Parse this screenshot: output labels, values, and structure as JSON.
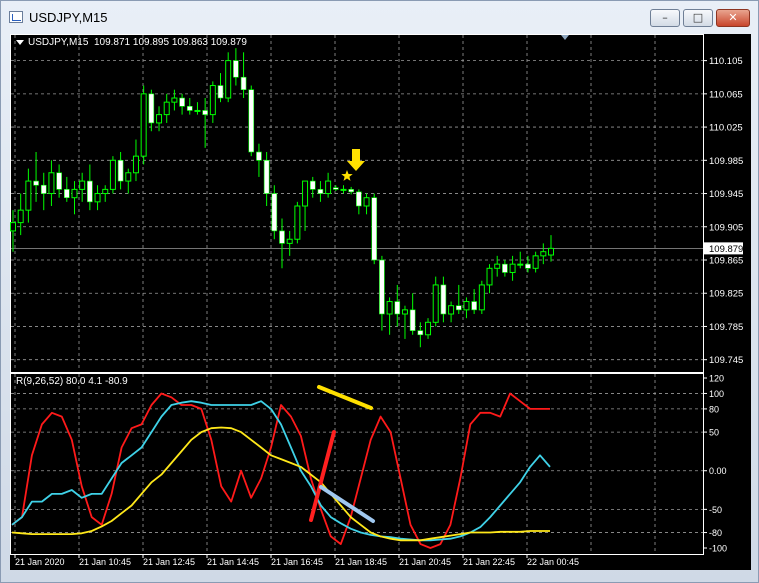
{
  "window": {
    "title": "USDJPY,M15",
    "minimize_glyph": "–",
    "maximize_glyph": "□",
    "close_glyph": "✕"
  },
  "chart_header": {
    "symbol": "USDJPY,M15",
    "ohlc": "109.871 109.895 109.863 109.879"
  },
  "indicator_header": {
    "label": "R(9,26,52) 80.0 4.1 -80.9"
  },
  "colors": {
    "background": "#000000",
    "grid": "#9a9a9a",
    "bull_candle": "#ffffff",
    "wick": "#00ff00",
    "current_price_line": "#9a9a9a",
    "red_line": "#ff1a1a",
    "cyan_line": "#3fd2e8",
    "yellow_line": "#ffe81a",
    "annotation_yellow": "#ffe000",
    "annotation_red": "#ff2020",
    "annotation_blue": "#a0c8f0"
  },
  "annotations": {
    "arrow": "down-arrow",
    "star": "star"
  },
  "chart_data": [
    {
      "type": "candlestick",
      "title": "USDJPY,M15",
      "ylim": [
        109.735,
        110.125
      ],
      "y_ticks": [
        "110.105",
        "110.065",
        "110.025",
        "109.985",
        "109.945",
        "109.905",
        "109.865",
        "109.825",
        "109.785",
        "109.745"
      ],
      "current_price": "109.879",
      "x_ticks": [
        "21 Jan 2020",
        "21 Jan 10:45",
        "21 Jan 12:45",
        "21 Jan 14:45",
        "21 Jan 16:45",
        "21 Jan 18:45",
        "21 Jan 20:45",
        "21 Jan 22:45",
        "22 Jan 00:45"
      ],
      "candles": [
        {
          "o": 109.9,
          "h": 109.925,
          "l": 109.875,
          "c": 109.91
        },
        {
          "o": 109.91,
          "h": 109.945,
          "l": 109.895,
          "c": 109.925
        },
        {
          "o": 109.925,
          "h": 109.975,
          "l": 109.91,
          "c": 109.96
        },
        {
          "o": 109.96,
          "h": 109.995,
          "l": 109.935,
          "c": 109.955
        },
        {
          "o": 109.955,
          "h": 109.97,
          "l": 109.925,
          "c": 109.945
        },
        {
          "o": 109.945,
          "h": 109.985,
          "l": 109.93,
          "c": 109.97
        },
        {
          "o": 109.97,
          "h": 109.98,
          "l": 109.94,
          "c": 109.95
        },
        {
          "o": 109.95,
          "h": 109.965,
          "l": 109.935,
          "c": 109.94
        },
        {
          "o": 109.94,
          "h": 109.96,
          "l": 109.92,
          "c": 109.95
        },
        {
          "o": 109.95,
          "h": 109.97,
          "l": 109.935,
          "c": 109.96
        },
        {
          "o": 109.96,
          "h": 109.98,
          "l": 109.925,
          "c": 109.935
        },
        {
          "o": 109.935,
          "h": 109.955,
          "l": 109.925,
          "c": 109.945
        },
        {
          "o": 109.945,
          "h": 109.955,
          "l": 109.935,
          "c": 109.95
        },
        {
          "o": 109.95,
          "h": 109.99,
          "l": 109.945,
          "c": 109.985
        },
        {
          "o": 109.985,
          "h": 109.995,
          "l": 109.95,
          "c": 109.96
        },
        {
          "o": 109.96,
          "h": 109.975,
          "l": 109.945,
          "c": 109.97
        },
        {
          "o": 109.97,
          "h": 110.01,
          "l": 109.96,
          "c": 109.99
        },
        {
          "o": 109.99,
          "h": 110.075,
          "l": 109.98,
          "c": 110.065
        },
        {
          "o": 110.065,
          "h": 110.07,
          "l": 110.02,
          "c": 110.03
        },
        {
          "o": 110.03,
          "h": 110.05,
          "l": 110.02,
          "c": 110.04
        },
        {
          "o": 110.04,
          "h": 110.065,
          "l": 110.03,
          "c": 110.055
        },
        {
          "o": 110.055,
          "h": 110.07,
          "l": 110.045,
          "c": 110.06
        },
        {
          "o": 110.06,
          "h": 110.065,
          "l": 110.04,
          "c": 110.05
        },
        {
          "o": 110.05,
          "h": 110.06,
          "l": 110.04,
          "c": 110.045
        },
        {
          "o": 110.045,
          "h": 110.055,
          "l": 110.04,
          "c": 110.045
        },
        {
          "o": 110.045,
          "h": 110.06,
          "l": 110.0,
          "c": 110.04
        },
        {
          "o": 110.04,
          "h": 110.08,
          "l": 110.03,
          "c": 110.075
        },
        {
          "o": 110.075,
          "h": 110.09,
          "l": 110.055,
          "c": 110.06
        },
        {
          "o": 110.06,
          "h": 110.115,
          "l": 110.055,
          "c": 110.105
        },
        {
          "o": 110.105,
          "h": 110.12,
          "l": 110.075,
          "c": 110.085
        },
        {
          "o": 110.085,
          "h": 110.115,
          "l": 110.06,
          "c": 110.07
        },
        {
          "o": 110.07,
          "h": 110.075,
          "l": 109.99,
          "c": 109.995
        },
        {
          "o": 109.995,
          "h": 110.005,
          "l": 109.965,
          "c": 109.985
        },
        {
          "o": 109.985,
          "h": 109.995,
          "l": 109.93,
          "c": 109.945
        },
        {
          "o": 109.945,
          "h": 109.955,
          "l": 109.89,
          "c": 109.9
        },
        {
          "o": 109.9,
          "h": 109.915,
          "l": 109.855,
          "c": 109.885
        },
        {
          "o": 109.885,
          "h": 109.9,
          "l": 109.87,
          "c": 109.89
        },
        {
          "o": 109.89,
          "h": 109.935,
          "l": 109.885,
          "c": 109.93
        },
        {
          "o": 109.93,
          "h": 109.96,
          "l": 109.9,
          "c": 109.96
        },
        {
          "o": 109.96,
          "h": 109.965,
          "l": 109.94,
          "c": 109.95
        },
        {
          "o": 109.95,
          "h": 109.96,
          "l": 109.935,
          "c": 109.945
        },
        {
          "o": 109.945,
          "h": 109.97,
          "l": 109.94,
          "c": 109.96
        },
        {
          "o": 109.952,
          "h": 109.955,
          "l": 109.948,
          "c": 109.95
        },
        {
          "o": 109.95,
          "h": 109.955,
          "l": 109.945,
          "c": 109.95
        },
        {
          "o": 109.95,
          "h": 109.953,
          "l": 109.944,
          "c": 109.947
        },
        {
          "o": 109.947,
          "h": 109.95,
          "l": 109.92,
          "c": 109.93
        },
        {
          "o": 109.93,
          "h": 109.945,
          "l": 109.92,
          "c": 109.94
        },
        {
          "o": 109.94,
          "h": 109.945,
          "l": 109.86,
          "c": 109.865
        },
        {
          "o": 109.865,
          "h": 109.87,
          "l": 109.78,
          "c": 109.8
        },
        {
          "o": 109.8,
          "h": 109.82,
          "l": 109.775,
          "c": 109.815
        },
        {
          "o": 109.815,
          "h": 109.835,
          "l": 109.785,
          "c": 109.8
        },
        {
          "o": 109.8,
          "h": 109.81,
          "l": 109.77,
          "c": 109.805
        },
        {
          "o": 109.805,
          "h": 109.825,
          "l": 109.775,
          "c": 109.78
        },
        {
          "o": 109.78,
          "h": 109.79,
          "l": 109.76,
          "c": 109.775
        },
        {
          "o": 109.775,
          "h": 109.795,
          "l": 109.77,
          "c": 109.79
        },
        {
          "o": 109.79,
          "h": 109.845,
          "l": 109.785,
          "c": 109.835
        },
        {
          "o": 109.835,
          "h": 109.845,
          "l": 109.79,
          "c": 109.8
        },
        {
          "o": 109.8,
          "h": 109.815,
          "l": 109.79,
          "c": 109.81
        },
        {
          "o": 109.81,
          "h": 109.835,
          "l": 109.8,
          "c": 109.805
        },
        {
          "o": 109.805,
          "h": 109.82,
          "l": 109.795,
          "c": 109.815
        },
        {
          "o": 109.815,
          "h": 109.83,
          "l": 109.8,
          "c": 109.805
        },
        {
          "o": 109.805,
          "h": 109.84,
          "l": 109.8,
          "c": 109.835
        },
        {
          "o": 109.835,
          "h": 109.86,
          "l": 109.825,
          "c": 109.855
        },
        {
          "o": 109.855,
          "h": 109.87,
          "l": 109.845,
          "c": 109.86
        },
        {
          "o": 109.86,
          "h": 109.865,
          "l": 109.845,
          "c": 109.85
        },
        {
          "o": 109.85,
          "h": 109.87,
          "l": 109.84,
          "c": 109.86
        },
        {
          "o": 109.86,
          "h": 109.875,
          "l": 109.855,
          "c": 109.86
        },
        {
          "o": 109.86,
          "h": 109.87,
          "l": 109.85,
          "c": 109.855
        },
        {
          "o": 109.855,
          "h": 109.875,
          "l": 109.85,
          "c": 109.87
        },
        {
          "o": 109.87,
          "h": 109.885,
          "l": 109.86,
          "c": 109.875
        },
        {
          "o": 109.871,
          "h": 109.895,
          "l": 109.863,
          "c": 109.879
        }
      ]
    },
    {
      "type": "line",
      "title": "R(9,26,52) 80.0 4.1 -80.9",
      "ylim": [
        -100,
        120
      ],
      "y_ticks": [
        "120",
        "100",
        "80",
        "50",
        "0.00",
        "-50",
        "-80",
        "-100"
      ],
      "series": [
        {
          "color": "red",
          "values": [
            -70,
            -60,
            20,
            60,
            75,
            70,
            40,
            -20,
            -60,
            -70,
            -30,
            30,
            55,
            60,
            85,
            100,
            95,
            85,
            85,
            80,
            40,
            -20,
            -40,
            0,
            -35,
            -10,
            30,
            85,
            70,
            45,
            -10,
            -50,
            -85,
            -95,
            -60,
            -10,
            40,
            70,
            50,
            -10,
            -70,
            -95,
            -100,
            -95,
            -70,
            -10,
            60,
            75,
            75,
            70,
            100,
            90,
            80,
            80,
            80
          ]
        },
        {
          "color": "cyan",
          "values": [
            -70,
            -60,
            -40,
            -40,
            -30,
            -30,
            -25,
            -35,
            -30,
            -30,
            -10,
            10,
            20,
            30,
            50,
            70,
            85,
            88,
            90,
            88,
            85,
            85,
            85,
            85,
            85,
            90,
            80,
            60,
            30,
            0,
            -20,
            -45,
            -60,
            -68,
            -75,
            -80,
            -83,
            -85,
            -86,
            -88,
            -89,
            -90,
            -90,
            -89,
            -88,
            -85,
            -80,
            -73,
            -60,
            -45,
            -30,
            -15,
            5,
            20,
            5
          ]
        },
        {
          "color": "yellow",
          "values": [
            -80,
            -81,
            -82,
            -82,
            -82,
            -82,
            -82,
            -81,
            -78,
            -72,
            -65,
            -55,
            -45,
            -30,
            -15,
            -5,
            10,
            25,
            40,
            50,
            55,
            56,
            55,
            50,
            40,
            30,
            20,
            15,
            10,
            5,
            -5,
            -15,
            -30,
            -45,
            -60,
            -70,
            -80,
            -85,
            -88,
            -90,
            -90,
            -90,
            -88,
            -86,
            -84,
            -82,
            -80,
            -80,
            -80,
            -79,
            -79,
            -79,
            -78,
            -78,
            -78
          ]
        }
      ]
    }
  ]
}
